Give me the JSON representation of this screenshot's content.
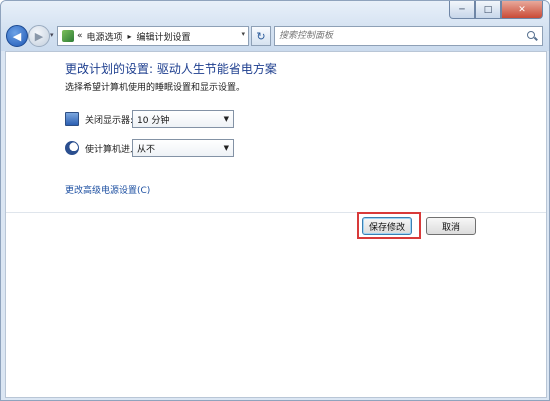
{
  "window": {
    "minimize": "─",
    "maximize": "□",
    "close": "✕"
  },
  "nav": {
    "back": "◀",
    "forward": "▶",
    "dropdown": "▾",
    "refresh": "↻"
  },
  "address": {
    "prefix": "«",
    "crumbs": [
      "电源选项",
      "编辑计划设置"
    ],
    "separator": "▸",
    "dropdown": "▾"
  },
  "search": {
    "placeholder": "搜索控制面板"
  },
  "page": {
    "title": "更改计划的设置: 驱动人生节能省电方案",
    "subtitle": "选择希望计算机使用的睡眠设置和显示设置。",
    "settings": [
      {
        "icon": "monitor-icon",
        "label": "关闭显示器:",
        "value": "10 分钟"
      },
      {
        "icon": "moon-icon",
        "label": "使计算机进入睡眠状态:",
        "value": "从不"
      }
    ],
    "advanced_link": "更改高级电源设置(C)",
    "save_label": "保存修改",
    "cancel_label": "取消"
  },
  "colors": {
    "heading": "#1e3f8f",
    "link": "#1e50a2",
    "highlight": "#d83a3a"
  }
}
